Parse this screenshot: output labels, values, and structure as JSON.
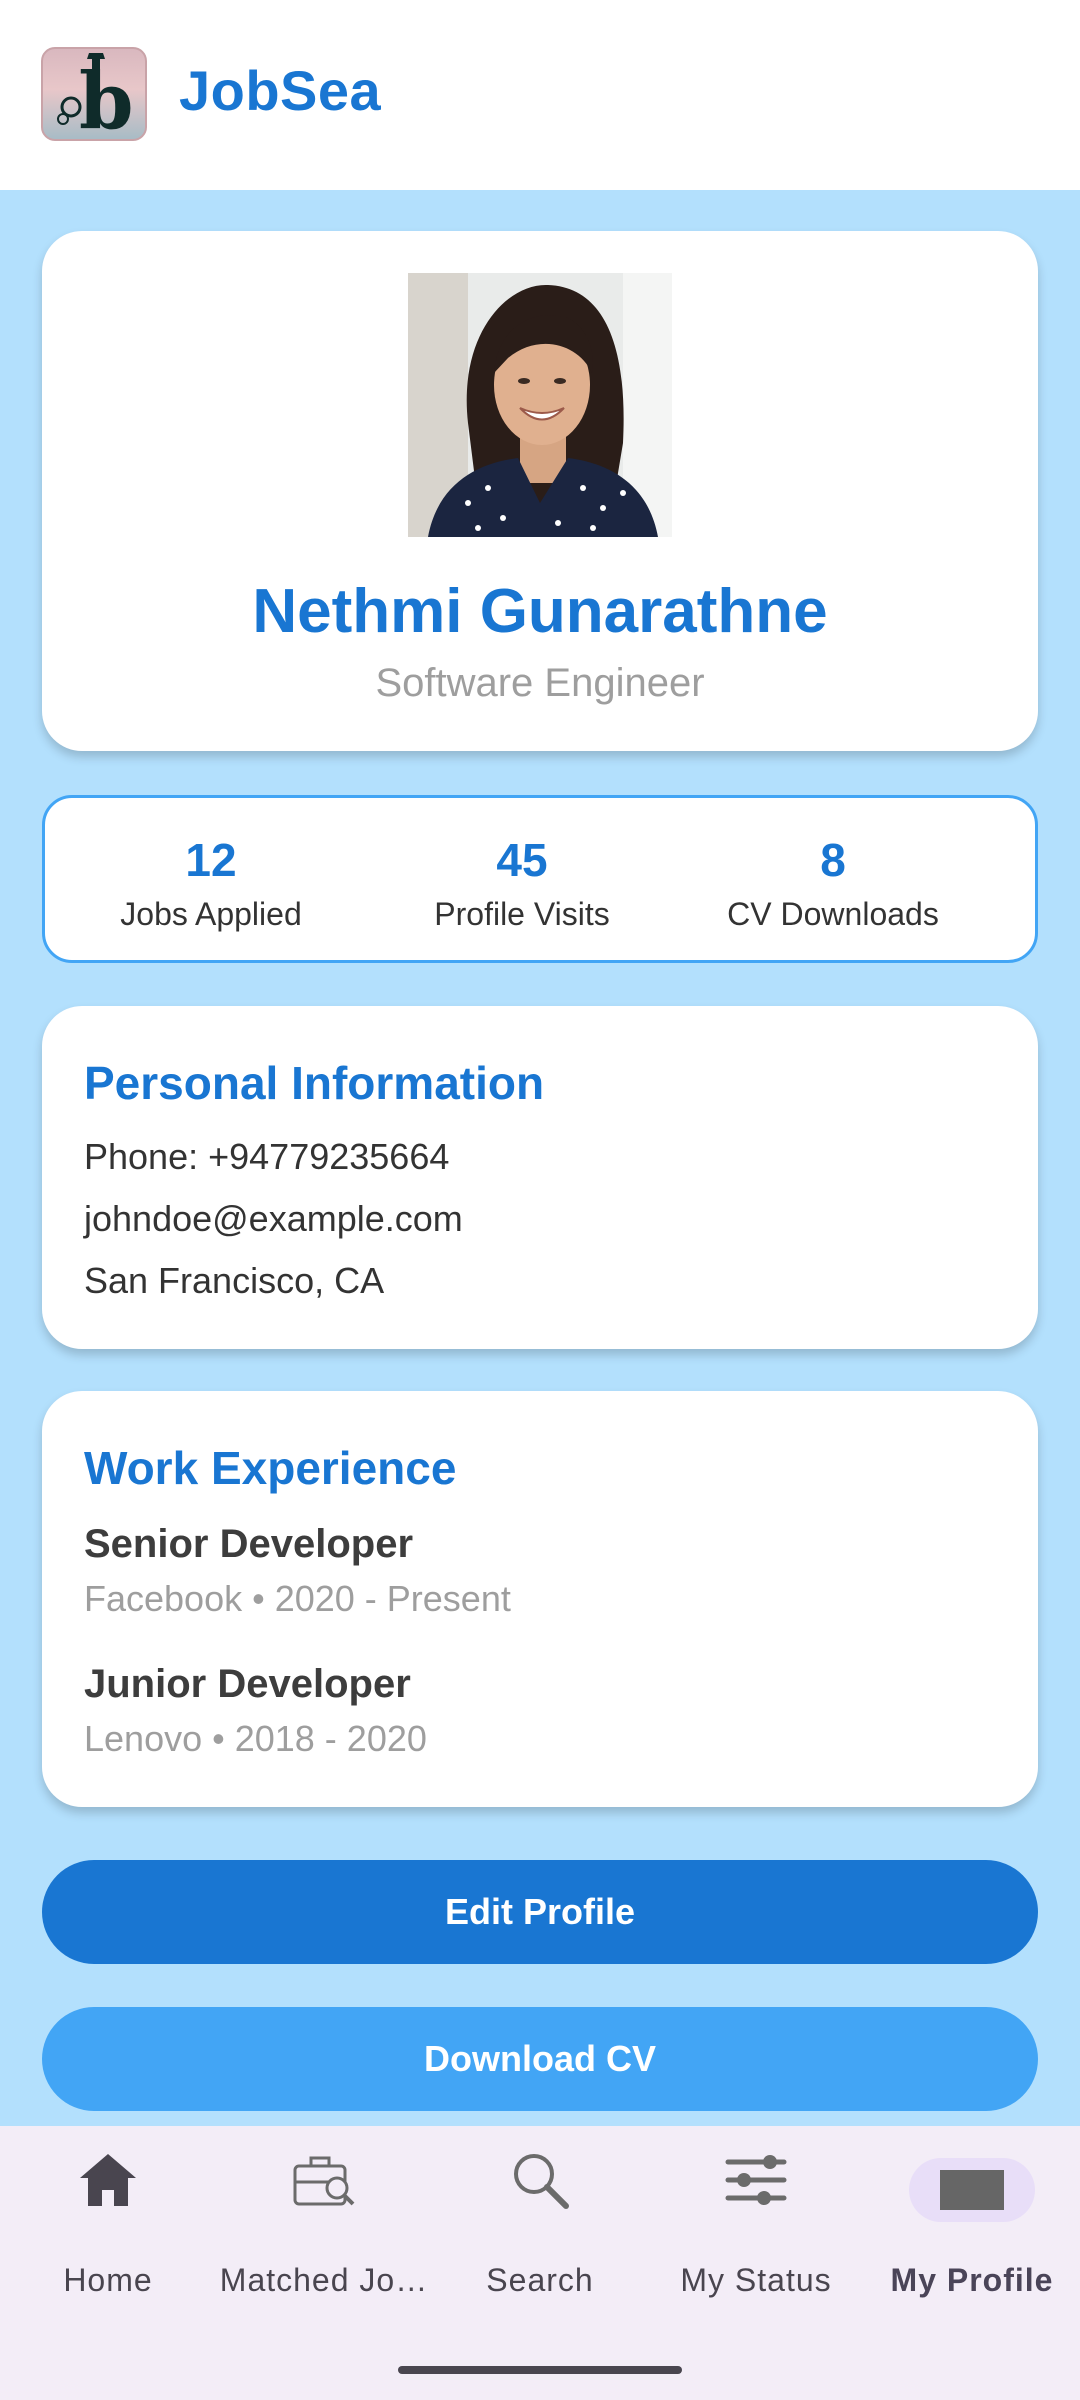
{
  "app": {
    "title": "JobSea",
    "logo_letter": "b"
  },
  "profile": {
    "name": "Nethmi Gunarathne",
    "title": "Software Engineer"
  },
  "stats": [
    {
      "value": "12",
      "label": "Jobs Applied"
    },
    {
      "value": "45",
      "label": "Profile Visits"
    },
    {
      "value": "8",
      "label": "CV Downloads"
    }
  ],
  "personal": {
    "heading": "Personal Information",
    "phone": "Phone: +94779235664",
    "email": "johndoe@example.com",
    "location": "San Francisco, CA"
  },
  "work": {
    "heading": "Work Experience",
    "jobs": [
      {
        "title": "Senior Developer",
        "meta": "Facebook • 2020 - Present"
      },
      {
        "title": "Junior Developer",
        "meta": "Lenovo • 2018 - 2020"
      }
    ]
  },
  "buttons": {
    "edit": "Edit Profile",
    "download": "Download CV"
  },
  "nav": {
    "items": [
      {
        "label": "Home",
        "icon": "home-icon"
      },
      {
        "label": "Matched Jo…",
        "icon": "briefcase-search-icon"
      },
      {
        "label": "Search",
        "icon": "search-icon"
      },
      {
        "label": "My Status",
        "icon": "sliders-icon"
      },
      {
        "label": "My Profile",
        "icon": "profile-icon",
        "active": true
      }
    ]
  },
  "colors": {
    "primary": "#1976d2",
    "accent": "#42a5f5",
    "background": "#b3e0fd",
    "nav_background": "#f3edf7"
  }
}
